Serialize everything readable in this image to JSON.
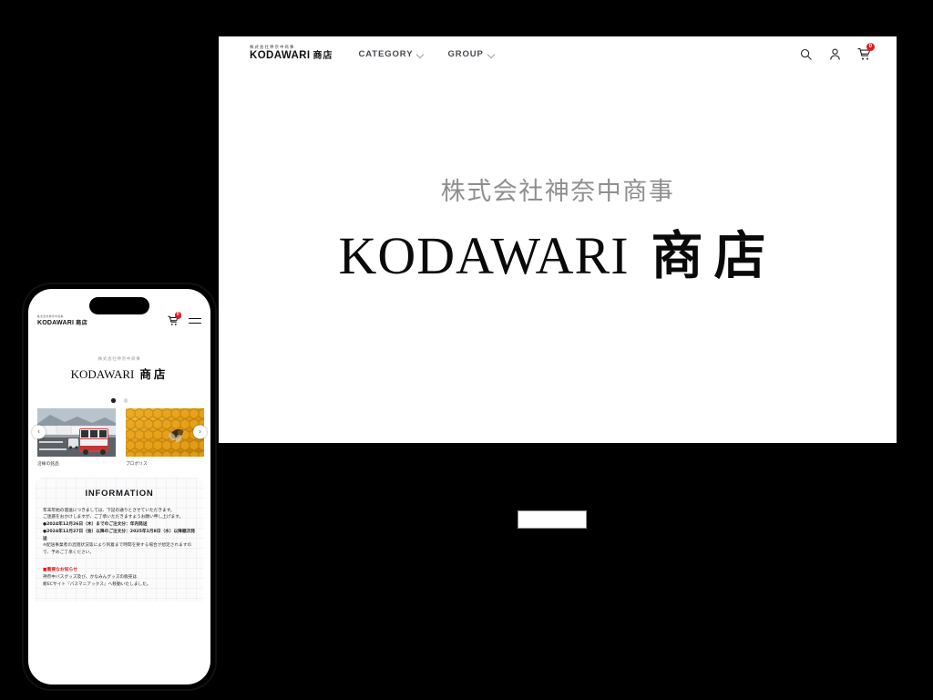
{
  "site": {
    "logo_sub": "株式会社神奈中商事",
    "logo_main_en": "KODAWARI",
    "logo_main_jp": "商店"
  },
  "desktop": {
    "nav": [
      {
        "label": "CATEGORY",
        "icon": "chevron-down-icon"
      },
      {
        "label": "GROUP",
        "icon": "chevron-down-icon"
      }
    ],
    "actions": {
      "search_icon": "search-icon",
      "account_icon": "user-icon",
      "cart_icon": "cart-icon",
      "cart_count": "0"
    },
    "hero": {
      "sub": "株式会社神奈中商事",
      "main_en": "KODAWARI",
      "main_jp": "商店"
    }
  },
  "phone": {
    "actions": {
      "cart_icon": "cart-icon",
      "cart_count": "0",
      "menu_icon": "hamburger-menu-icon"
    },
    "hero": {
      "sub": "株式会社神奈中商事",
      "main_en": "KODAWARI",
      "main_jp": "商店"
    },
    "carousel": {
      "prev_label": "‹",
      "next_label": "›",
      "dots": [
        "active",
        "inactive"
      ],
      "cards": [
        {
          "label": "沿線の銘品",
          "image": "bus-photo"
        },
        {
          "label": "プロポリス",
          "image": "honeycomb-photo"
        }
      ]
    },
    "information": {
      "title": "INFORMATION",
      "lines": [
        "年末年始の発送につきましては、下記の通りとさせていただきます。",
        "ご迷惑をおかけしますが、ご了承いただきますようお願い申し上げます。",
        "●2024年12月26日（木）までのご注文分：年内発送",
        "●2024年12月27日（金）以降のご注文分：2025年1月8日（水）以降順次発送",
        "※配送事業者の混雑状況等により到着まで時間を要する場合が想定されますので、予めご了承ください。"
      ],
      "notice_head": "■重要なお知らせ",
      "notice_lines": [
        "神奈中バスグッズ及び、かなみんグッズの販売は",
        "新ECサイト『バスマニアックス』へ移動いたしました。"
      ]
    }
  },
  "colors": {
    "accent_red": "#e01b22",
    "background": "#000000",
    "panel": "#ffffff",
    "muted_text": "#8f8f8f"
  }
}
